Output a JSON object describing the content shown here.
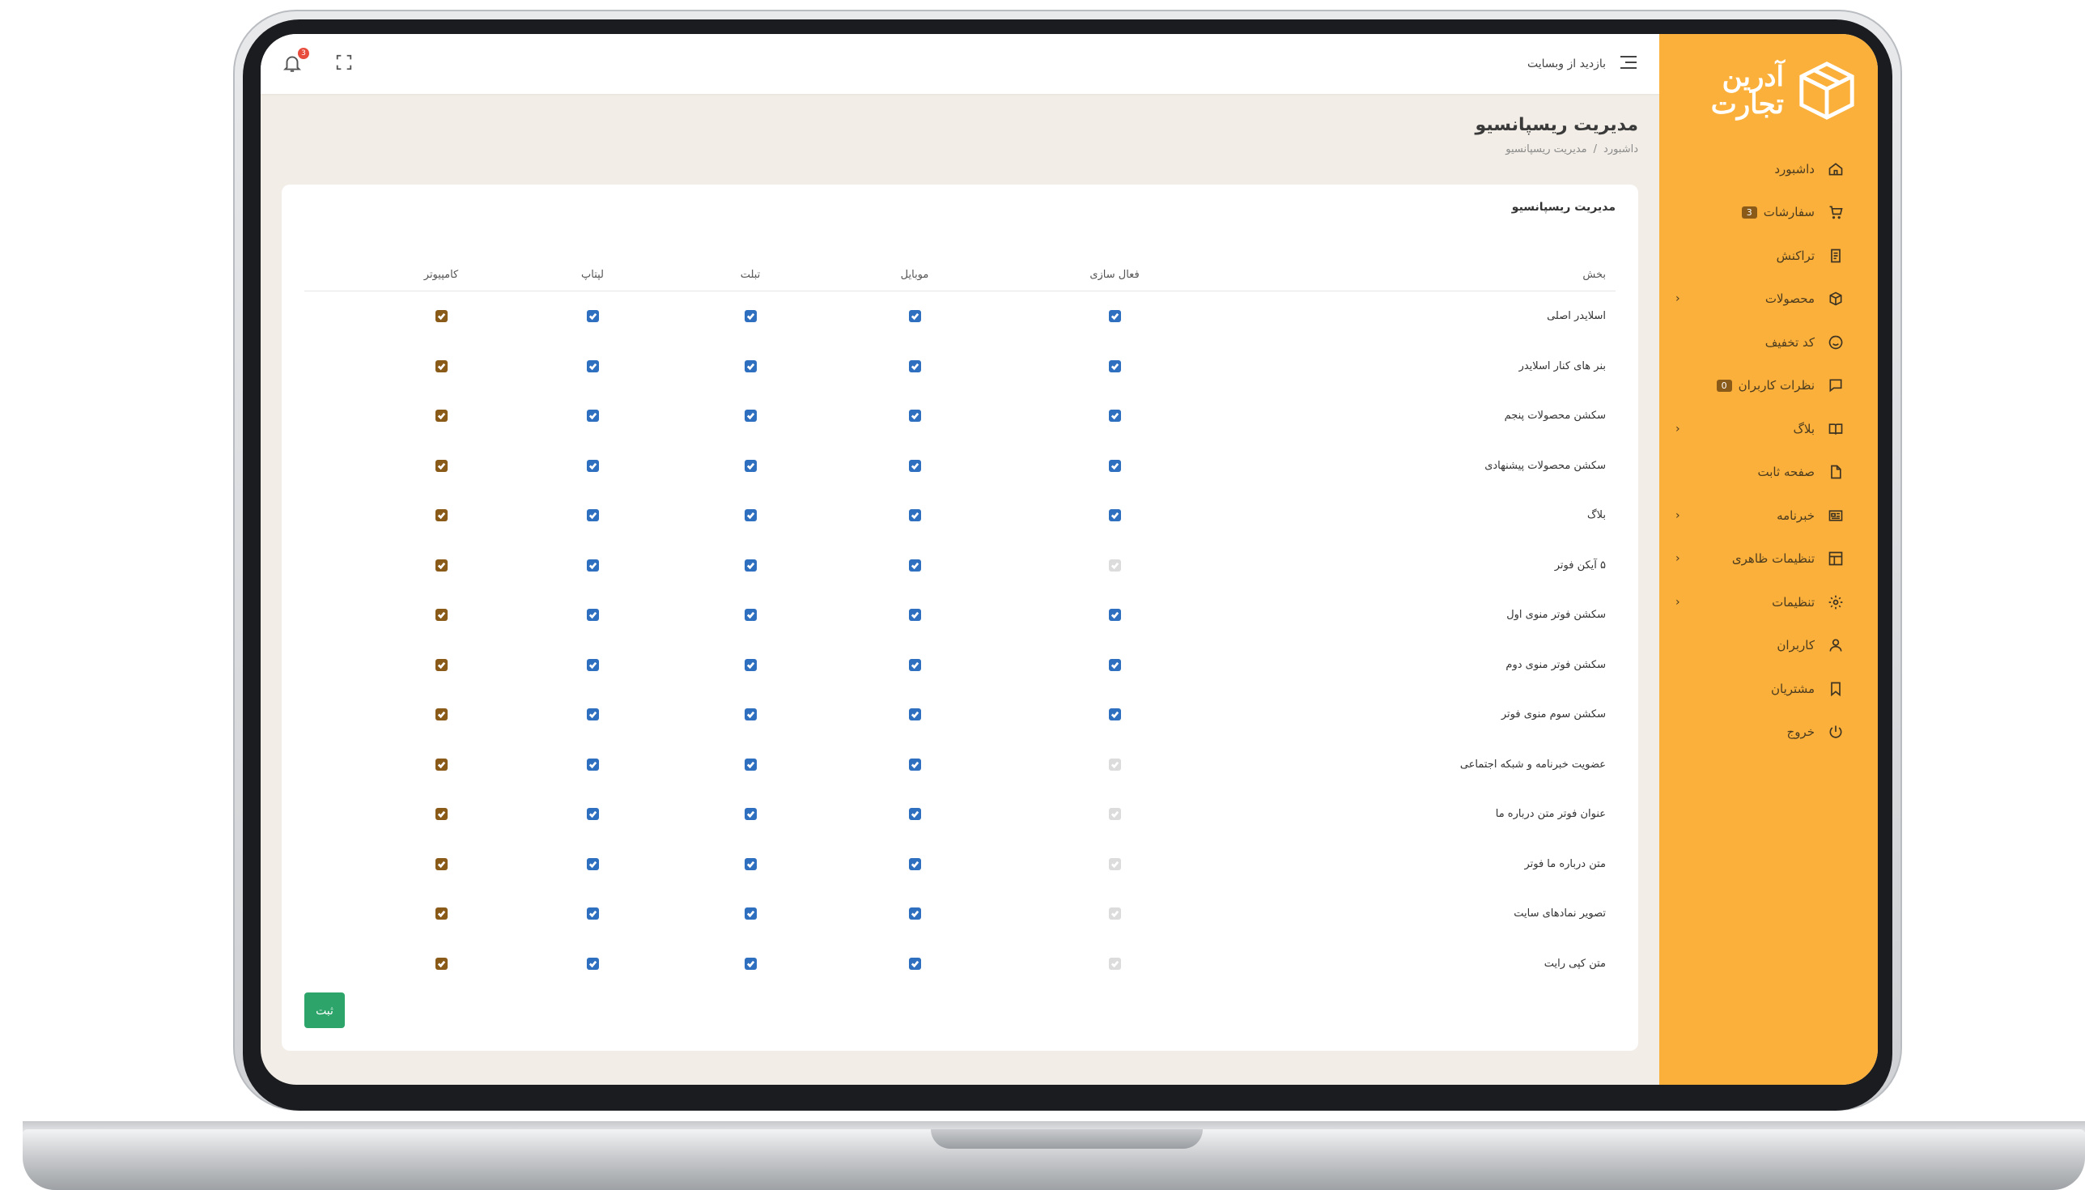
{
  "brand": {
    "line1": "آدرین",
    "line2": "تجارت",
    "accent": "#fbb03b"
  },
  "topbar": {
    "visit_site": "بازدید از وبسایت",
    "notification_count": "3"
  },
  "sidebar": {
    "items": [
      {
        "label": "داشبورد",
        "icon": "home-icon"
      },
      {
        "label": "سفارشات",
        "icon": "cart-icon",
        "badge": "3"
      },
      {
        "label": "تراکنش",
        "icon": "receipt-icon"
      },
      {
        "label": "محصولات",
        "icon": "box-icon",
        "chevron": true
      },
      {
        "label": "کد تخفیف",
        "icon": "smile-icon"
      },
      {
        "label": "نظرات کاربران",
        "icon": "comment-icon",
        "badge": "0"
      },
      {
        "label": "بلاگ",
        "icon": "book-icon",
        "chevron": true
      },
      {
        "label": "صفحه ثابت",
        "icon": "file-icon"
      },
      {
        "label": "خبرنامه",
        "icon": "newsletter-icon",
        "chevron": true
      },
      {
        "label": "تنظیمات ظاهری",
        "icon": "layout-icon",
        "chevron": true
      },
      {
        "label": "تنظیمات",
        "icon": "gear-icon",
        "chevron": true
      },
      {
        "label": "کاربران",
        "icon": "user-icon"
      },
      {
        "label": "مشتریان",
        "icon": "bookmark-icon"
      },
      {
        "label": "خروج",
        "icon": "power-icon"
      }
    ]
  },
  "page": {
    "title": "مدیریت ریسپانسیو",
    "breadcrumb_home": "داشبورد",
    "breadcrumb_sep": "/",
    "breadcrumb_current": "مدیریت ریسپانسیو"
  },
  "card": {
    "title": "مدیریت ریسپانسیو",
    "columns": {
      "section": "بخش",
      "active": "فعال سازی",
      "mobile": "موبایل",
      "tablet": "تبلت",
      "laptop": "لپتاپ",
      "desktop": "کامپیوتر"
    },
    "rows": [
      {
        "section": "اسلایدر اصلی",
        "active": true
      },
      {
        "section": "بنر های کنار اسلایدر",
        "active": true
      },
      {
        "section": "سکشن محصولات پنجم",
        "active": true
      },
      {
        "section": "سکشن محصولات پیشنهادی",
        "active": true
      },
      {
        "section": "بلاگ",
        "active": true
      },
      {
        "section": "۵ آیکن فوتر",
        "active": false
      },
      {
        "section": "سکشن فوتر منوی اول",
        "active": true
      },
      {
        "section": "سکشن فوتر منوی دوم",
        "active": true
      },
      {
        "section": "سکشن سوم منوی فوتر",
        "active": true
      },
      {
        "section": "عضویت خبرنامه و شبکه اجتماعی",
        "active": false
      },
      {
        "section": "عنوان فوتر متن درباره ما",
        "active": false
      },
      {
        "section": "متن درباره ما فوتر",
        "active": false
      },
      {
        "section": "تصویر نمادهای سایت",
        "active": false
      },
      {
        "section": "متن کپی رایت",
        "active": false
      }
    ],
    "submit_label": "ثبت"
  }
}
